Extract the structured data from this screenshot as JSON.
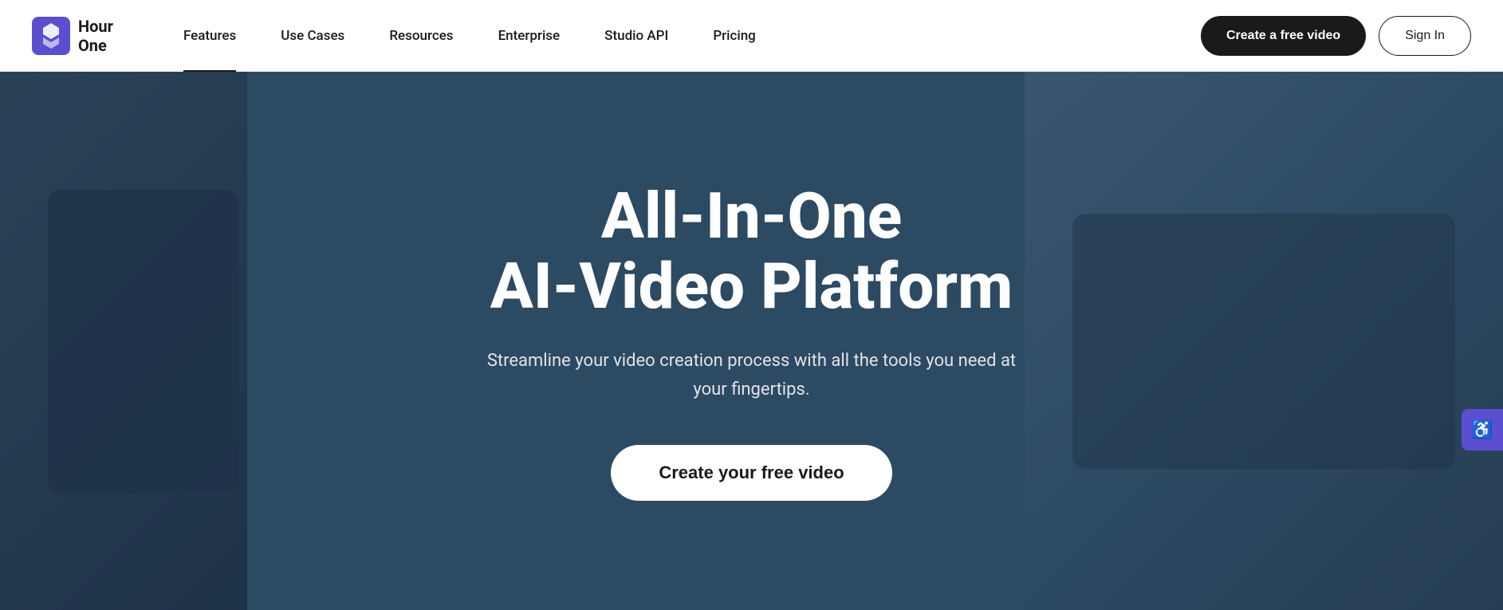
{
  "brand": {
    "name_line1": "Hour",
    "name_line2": "One",
    "logo_alt": "Hour One logo"
  },
  "nav": {
    "items": [
      {
        "id": "features",
        "label": "Features",
        "active": true
      },
      {
        "id": "use-cases",
        "label": "Use Cases",
        "active": false
      },
      {
        "id": "resources",
        "label": "Resources",
        "active": false
      },
      {
        "id": "enterprise",
        "label": "Enterprise",
        "active": false
      },
      {
        "id": "studio-api",
        "label": "Studio API",
        "active": false
      },
      {
        "id": "pricing",
        "label": "Pricing",
        "active": false
      }
    ],
    "create_btn": "Create a free video",
    "signin_btn": "Sign In"
  },
  "hero": {
    "title_line1": "All-In-One",
    "title_line2": "AI-Video Platform",
    "subtitle": "Streamline your video creation process with all the tools you need at your fingertips.",
    "cta_label": "Create your free video"
  },
  "accessibility": {
    "icon": "♿",
    "label": "Accessibility"
  }
}
